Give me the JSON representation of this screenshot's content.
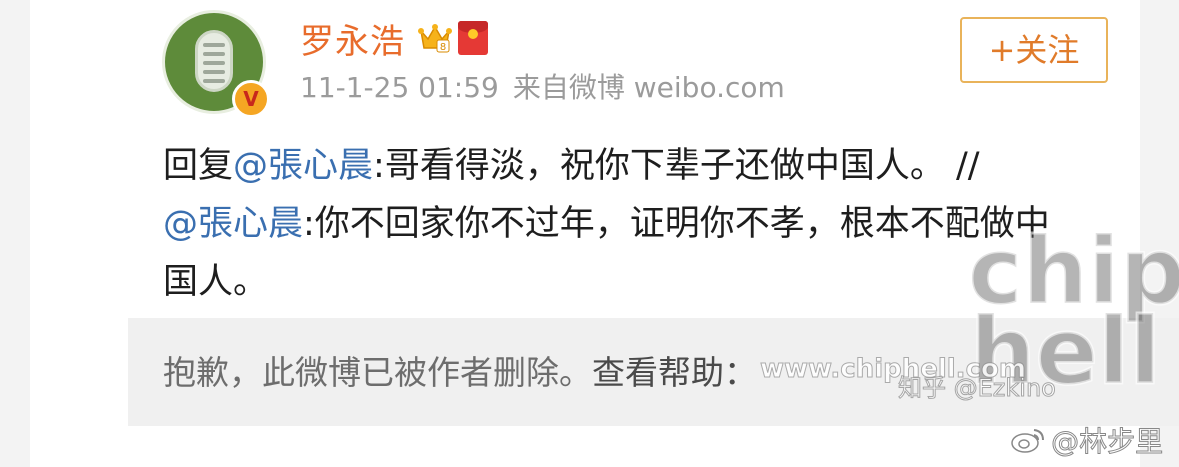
{
  "post": {
    "username": "罗永浩",
    "timestamp": "11-1-25 01:59",
    "source": "来自微博 weibo.com",
    "follow_label": "+关注",
    "verified_badge": "V",
    "body": {
      "p1": "回复",
      "m1": "@張心晨",
      "p2": ":哥看得淡，祝你下辈子还做中国人。 //",
      "m2": "@張心晨",
      "p3": ":你不回家你不过年，证明你不孝，根本不配做中国人。"
    },
    "deleted": {
      "message": "抱歉，此微博已被作者删除。",
      "help": "查看帮助："
    }
  },
  "watermarks": {
    "chip": "chip",
    "hell": "hell",
    "url": "www.chiphell.com",
    "zhihu": "知乎 @Ezkino",
    "weibo_handle": "@林步里"
  },
  "colors": {
    "username": "#e86c2c",
    "mention": "#3a6fb0",
    "follow_border": "#e9b35a"
  }
}
